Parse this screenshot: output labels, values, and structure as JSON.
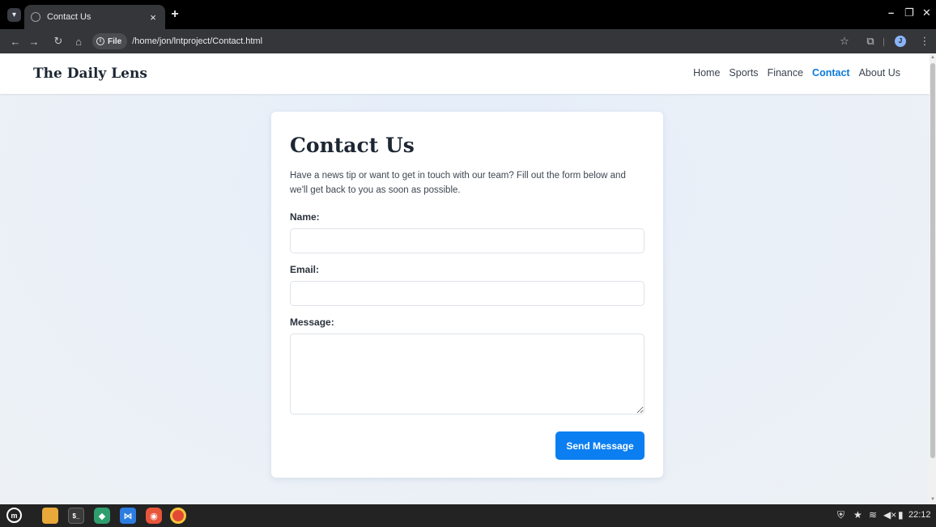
{
  "browser": {
    "tab_title": "Contact Us",
    "tab_close": "×",
    "new_tab": "+",
    "address_chip": "File",
    "address_url": "/home/jon/lntproject/Contact.html",
    "profile_initial": "J"
  },
  "site": {
    "brand": "The Daily Lens",
    "nav": [
      {
        "label": "Home"
      },
      {
        "label": "Sports"
      },
      {
        "label": "Finance"
      },
      {
        "label": "Contact",
        "active": true
      },
      {
        "label": "About Us"
      }
    ]
  },
  "contact": {
    "title": "Contact Us",
    "intro": "Have a news tip or want to get in touch with our team? Fill out the form below and we'll get back to you as soon as possible.",
    "name_label": "Name:",
    "name_value": "",
    "email_label": "Email:",
    "email_value": "",
    "message_label": "Message:",
    "message_value": "",
    "submit_label": "Send Message"
  },
  "taskbar": {
    "clock": "22:12"
  },
  "colors": {
    "accent": "#0b7ff1",
    "nav_active": "#0d7ad9",
    "heading": "#1d2733"
  },
  "icons": {
    "tabbar": [
      "tab-search-icon",
      "globe-icon",
      "close-icon",
      "plus-icon",
      "minimize-icon",
      "restore-icon"
    ],
    "toolbar": [
      "back-arrow-icon",
      "forward-arrow-icon",
      "reload-icon",
      "home-icon",
      "info-icon",
      "star-icon",
      "extensions-icon",
      "kebab-menu-icon"
    ],
    "taskbar": [
      "mint-menu-icon",
      "files-icon",
      "terminal-icon",
      "app-icon",
      "vscode-icon",
      "app-icon",
      "chrome-icon"
    ],
    "tray": [
      "shield-icon",
      "star-icon",
      "wifi-icon",
      "volume-icon",
      "battery-icon"
    ]
  }
}
